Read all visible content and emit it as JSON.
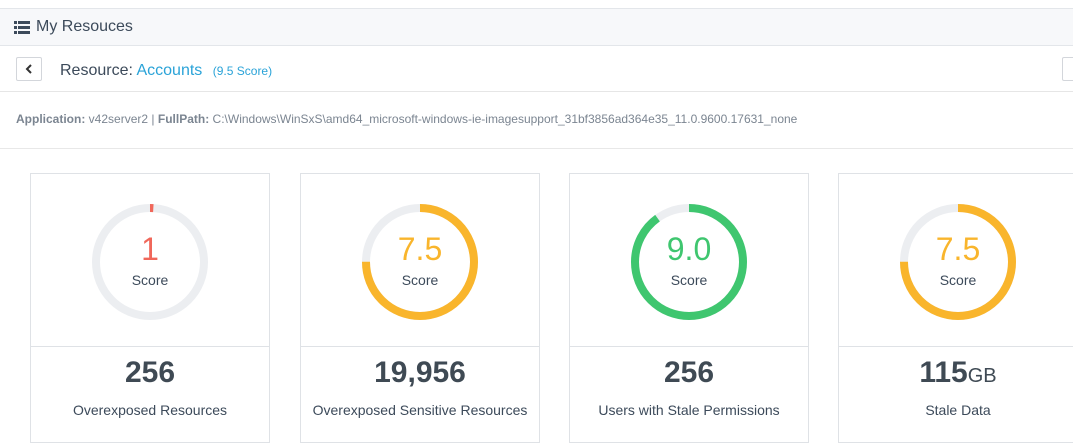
{
  "header": {
    "title": "My Resouces",
    "icon": "list-icon"
  },
  "resource": {
    "back_icon": "chevron-left-icon",
    "label": "Resource:",
    "name": "Accounts",
    "score": "(9.5 Score)"
  },
  "application": {
    "app_label": "Application:",
    "app_value": "v42server2",
    "divider": "|",
    "path_label": "FullPath:",
    "path_value": "C:\\Windows\\WinSxS\\amd64_microsoft-windows-ie-imagesupport_31bf3856ad364e35_11.0.9600.17631_none"
  },
  "cards": [
    {
      "score_text": "1",
      "score_fraction": 0.01,
      "color": "#f0675a",
      "score_label": "Score",
      "metric": "256",
      "unit": "",
      "label": "Overexposed Resources"
    },
    {
      "score_text": "7.5",
      "score_fraction": 0.75,
      "color": "#f9b52c",
      "score_label": "Score",
      "metric": "19,956",
      "unit": "",
      "label": "Overexposed Sensitive Resources"
    },
    {
      "score_text": "9.0",
      "score_fraction": 0.9,
      "color": "#3fc66f",
      "score_label": "Score",
      "metric": "256",
      "unit": "",
      "label": "Users with Stale Permissions"
    },
    {
      "score_text": "7.5",
      "score_fraction": 0.75,
      "color": "#f9b52c",
      "score_label": "Score",
      "metric": "115",
      "unit": "GB",
      "label": "Stale Data"
    }
  ],
  "colors": {
    "track": "#eceef1",
    "link": "#2aa3d8"
  }
}
